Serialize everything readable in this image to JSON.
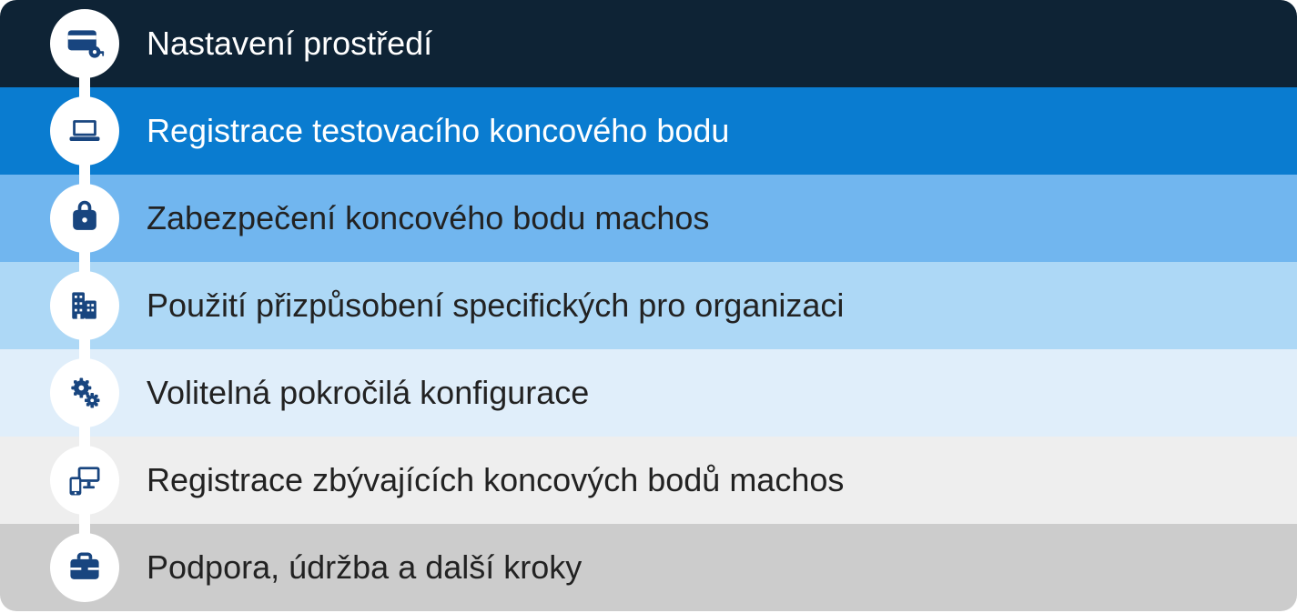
{
  "icon_color": "#18457f",
  "steps": [
    {
      "label": "Nastavení prostředí",
      "bg": "#0e2335",
      "text": "#ffffff",
      "icon": "card-key"
    },
    {
      "label": "Registrace testovacího koncového bodu",
      "bg": "#0a7cd0",
      "text": "#ffffff",
      "icon": "laptop"
    },
    {
      "label": "Zabezpečení koncového bodu machos",
      "bg": "#71b6ef",
      "text": "#222222",
      "icon": "lock-bag"
    },
    {
      "label": "Použití přizpůsobení specifických pro organizaci",
      "bg": "#add8f6",
      "text": "#222222",
      "icon": "building"
    },
    {
      "label": "Volitelná pokročilá konfigurace",
      "bg": "#e0eefa",
      "text": "#222222",
      "icon": "gears"
    },
    {
      "label": "Registrace zbývajících koncových bodů machos",
      "bg": "#eeeeee",
      "text": "#222222",
      "icon": "devices"
    },
    {
      "label": "Podpora, údržba a další kroky",
      "bg": "#cccccc",
      "text": "#222222",
      "icon": "briefcase"
    }
  ]
}
